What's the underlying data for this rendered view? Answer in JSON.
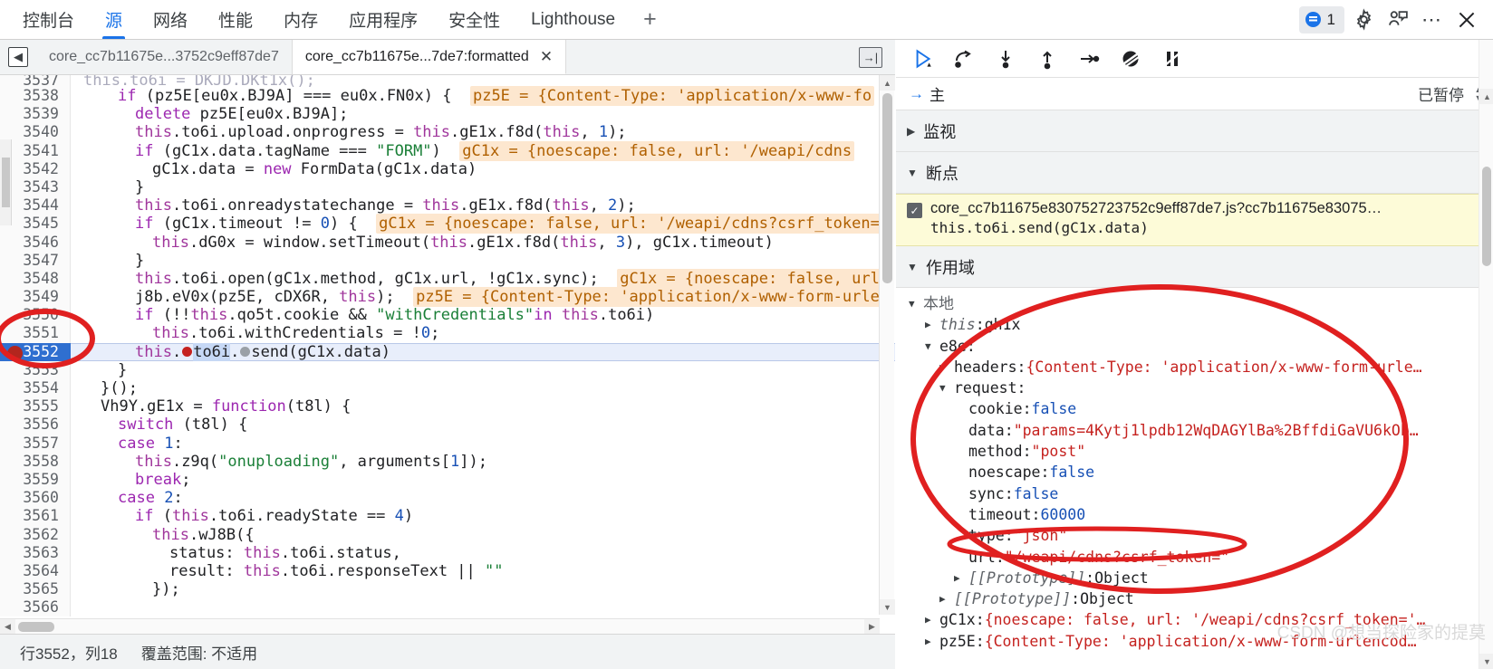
{
  "topbar": {
    "tabs": [
      {
        "label": "控制台",
        "selected": false
      },
      {
        "label": "源",
        "selected": true
      },
      {
        "label": "网络",
        "selected": false
      },
      {
        "label": "性能",
        "selected": false
      },
      {
        "label": "内存",
        "selected": false
      },
      {
        "label": "应用程序",
        "selected": false
      },
      {
        "label": "安全性",
        "selected": false
      },
      {
        "label": "Lighthouse",
        "selected": false
      }
    ],
    "add_tab_label": "+",
    "issues_count": "1",
    "icons": [
      "issues-icon",
      "gear-icon",
      "feedback-icon",
      "more-options-icon",
      "close-icon"
    ]
  },
  "filetabs": {
    "back_icon": "navigate-back-icon",
    "tabs": [
      {
        "label": "core_cc7b11675e...3752c9eff87de7",
        "active": false,
        "closable": false
      },
      {
        "label": "core_cc7b11675e...7de7:formatted",
        "active": true,
        "closable": true,
        "close_label": "✕"
      }
    ],
    "popout_icon": "open-in-new-panel-icon"
  },
  "editor": {
    "first_partial_line": "3537",
    "first_partial_text": "this.to6i = DKJD.DKt1x();",
    "lines": [
      {
        "n": "3538",
        "indent": 2,
        "segments": [
          {
            "t": "if",
            "c": "kw"
          },
          {
            "t": " (pz5E[eu0x.BJ9A] === eu0x.FN0x) {",
            "c": ""
          },
          {
            "t": "INLINE",
            "c": "",
            "v": "pz5E = {Content-Type: 'application/x-www-fo"
          }
        ]
      },
      {
        "n": "3539",
        "indent": 3,
        "segments": [
          {
            "t": "delete",
            "c": "kw"
          },
          {
            "t": " pz5E[eu0x.BJ9A];",
            "c": ""
          }
        ]
      },
      {
        "n": "3540",
        "indent": 3,
        "segments": [
          {
            "t": "this",
            "c": "this"
          },
          {
            "t": ".to6i.upload.onprogress = ",
            "c": ""
          },
          {
            "t": "this",
            "c": "this"
          },
          {
            "t": ".gE1x.f8d(",
            "c": ""
          },
          {
            "t": "this",
            "c": "this"
          },
          {
            "t": ", ",
            "c": ""
          },
          {
            "t": "1",
            "c": "num"
          },
          {
            "t": ");",
            "c": ""
          }
        ]
      },
      {
        "n": "3541",
        "indent": 3,
        "segments": [
          {
            "t": "if",
            "c": "kw"
          },
          {
            "t": " (gC1x.data.tagName === ",
            "c": ""
          },
          {
            "t": "\"FORM\"",
            "c": "str"
          },
          {
            "t": ")",
            "c": ""
          },
          {
            "t": "INLINE",
            "c": "",
            "v": "gC1x = {noescape: false, url: '/weapi/cdns"
          }
        ]
      },
      {
        "n": "3542",
        "indent": 4,
        "segments": [
          {
            "t": "gC1x.data = ",
            "c": ""
          },
          {
            "t": "new",
            "c": "kw"
          },
          {
            "t": " FormData(gC1x.data)",
            "c": ""
          }
        ]
      },
      {
        "n": "3543",
        "indent": 3,
        "segments": [
          {
            "t": "}",
            "c": ""
          }
        ]
      },
      {
        "n": "3544",
        "indent": 3,
        "segments": [
          {
            "t": "this",
            "c": "this"
          },
          {
            "t": ".to6i.onreadystatechange = ",
            "c": ""
          },
          {
            "t": "this",
            "c": "this"
          },
          {
            "t": ".gE1x.f8d(",
            "c": ""
          },
          {
            "t": "this",
            "c": "this"
          },
          {
            "t": ", ",
            "c": ""
          },
          {
            "t": "2",
            "c": "num"
          },
          {
            "t": ");",
            "c": ""
          }
        ]
      },
      {
        "n": "3545",
        "indent": 3,
        "segments": [
          {
            "t": "if",
            "c": "kw"
          },
          {
            "t": " (gC1x.timeout != ",
            "c": ""
          },
          {
            "t": "0",
            "c": "num"
          },
          {
            "t": ") {",
            "c": ""
          },
          {
            "t": "INLINE",
            "c": "",
            "v": "gC1x = {noescape: false, url: '/weapi/cdns?csrf_token="
          }
        ]
      },
      {
        "n": "3546",
        "indent": 4,
        "segments": [
          {
            "t": "this",
            "c": "this"
          },
          {
            "t": ".dG0x = window.setTimeout(",
            "c": ""
          },
          {
            "t": "this",
            "c": "this"
          },
          {
            "t": ".gE1x.f8d(",
            "c": ""
          },
          {
            "t": "this",
            "c": "this"
          },
          {
            "t": ", ",
            "c": ""
          },
          {
            "t": "3",
            "c": "num"
          },
          {
            "t": "), gC1x.timeout)",
            "c": ""
          }
        ]
      },
      {
        "n": "3547",
        "indent": 3,
        "segments": [
          {
            "t": "}",
            "c": ""
          }
        ]
      },
      {
        "n": "3548",
        "indent": 3,
        "segments": [
          {
            "t": "this",
            "c": "this"
          },
          {
            "t": ".to6i.open(gC1x.method, gC1x.url, !gC1x.sync);",
            "c": ""
          },
          {
            "t": "INLINE",
            "c": "",
            "v": "gC1x = {noescape: false, url"
          }
        ]
      },
      {
        "n": "3549",
        "indent": 3,
        "segments": [
          {
            "t": "j8b.eV0x(pz5E, cDX6R, ",
            "c": ""
          },
          {
            "t": "this",
            "c": "this"
          },
          {
            "t": ");",
            "c": ""
          },
          {
            "t": "INLINE",
            "c": "",
            "v": "pz5E = {Content-Type: 'application/x-www-form-urler"
          }
        ]
      },
      {
        "n": "3550",
        "indent": 3,
        "segments": [
          {
            "t": "if",
            "c": "kw"
          },
          {
            "t": " (!!",
            "c": ""
          },
          {
            "t": "this",
            "c": "this"
          },
          {
            "t": ".qo5t.cookie && ",
            "c": ""
          },
          {
            "t": "\"withCredentials\"",
            "c": "str"
          },
          {
            "t": "in",
            "c": "kw"
          },
          {
            "t": " ",
            "c": ""
          },
          {
            "t": "this",
            "c": "this"
          },
          {
            "t": ".to6i)",
            "c": ""
          }
        ]
      },
      {
        "n": "3551",
        "indent": 4,
        "segments": [
          {
            "t": "this",
            "c": "this"
          },
          {
            "t": ".to6i.withCredentials = !",
            "c": ""
          },
          {
            "t": "0",
            "c": "num"
          },
          {
            "t": ";",
            "c": ""
          }
        ]
      },
      {
        "n": "3552",
        "indent": 3,
        "highlight": true,
        "breakpoint": true,
        "segments": [
          {
            "t": "this",
            "c": "this"
          },
          {
            "t": ".",
            "c": ""
          },
          {
            "t": "BPDOT",
            "c": ""
          },
          {
            "t": "to6i",
            "c": "sel"
          },
          {
            "t": ".",
            "c": ""
          },
          {
            "t": "BPDOTGREY",
            "c": ""
          },
          {
            "t": "send(gC1x.data)",
            "c": ""
          }
        ]
      },
      {
        "n": "3553",
        "indent": 2,
        "segments": [
          {
            "t": "}",
            "c": ""
          }
        ]
      },
      {
        "n": "3554",
        "indent": 1,
        "segments": [
          {
            "t": "}();",
            "c": ""
          }
        ]
      },
      {
        "n": "3555",
        "indent": 1,
        "segments": [
          {
            "t": "Vh9Y.gE1x = ",
            "c": ""
          },
          {
            "t": "function",
            "c": "kw"
          },
          {
            "t": "(t8l) {",
            "c": ""
          }
        ]
      },
      {
        "n": "3556",
        "indent": 2,
        "segments": [
          {
            "t": "switch",
            "c": "kw"
          },
          {
            "t": " (t8l) {",
            "c": ""
          }
        ]
      },
      {
        "n": "3557",
        "indent": 2,
        "segments": [
          {
            "t": "case",
            "c": "kw"
          },
          {
            "t": " ",
            "c": ""
          },
          {
            "t": "1",
            "c": "num"
          },
          {
            "t": ":",
            "c": ""
          }
        ]
      },
      {
        "n": "3558",
        "indent": 3,
        "segments": [
          {
            "t": "this",
            "c": "this"
          },
          {
            "t": ".z9q(",
            "c": ""
          },
          {
            "t": "\"onuploading\"",
            "c": "str"
          },
          {
            "t": ", arguments[",
            "c": ""
          },
          {
            "t": "1",
            "c": "num"
          },
          {
            "t": "]);",
            "c": ""
          }
        ]
      },
      {
        "n": "3559",
        "indent": 3,
        "segments": [
          {
            "t": "break",
            "c": "kw"
          },
          {
            "t": ";",
            "c": ""
          }
        ]
      },
      {
        "n": "3560",
        "indent": 2,
        "segments": [
          {
            "t": "case",
            "c": "kw"
          },
          {
            "t": " ",
            "c": ""
          },
          {
            "t": "2",
            "c": "num"
          },
          {
            "t": ":",
            "c": ""
          }
        ]
      },
      {
        "n": "3561",
        "indent": 3,
        "segments": [
          {
            "t": "if",
            "c": "kw"
          },
          {
            "t": " (",
            "c": ""
          },
          {
            "t": "this",
            "c": "this"
          },
          {
            "t": ".to6i.readyState == ",
            "c": ""
          },
          {
            "t": "4",
            "c": "num"
          },
          {
            "t": ")",
            "c": ""
          }
        ]
      },
      {
        "n": "3562",
        "indent": 4,
        "segments": [
          {
            "t": "this",
            "c": "this"
          },
          {
            "t": ".wJ8B({",
            "c": ""
          }
        ]
      },
      {
        "n": "3563",
        "indent": 5,
        "segments": [
          {
            "t": "status: ",
            "c": ""
          },
          {
            "t": "this",
            "c": "this"
          },
          {
            "t": ".to6i.status,",
            "c": ""
          }
        ]
      },
      {
        "n": "3564",
        "indent": 5,
        "segments": [
          {
            "t": "result: ",
            "c": ""
          },
          {
            "t": "this",
            "c": "this"
          },
          {
            "t": ".to6i.responseText || ",
            "c": ""
          },
          {
            "t": "\"\"",
            "c": "str"
          }
        ]
      },
      {
        "n": "3565",
        "indent": 4,
        "segments": [
          {
            "t": "});",
            "c": ""
          }
        ]
      },
      {
        "n": "3566",
        "indent": 0,
        "segments": []
      }
    ]
  },
  "statusbar": {
    "position": "行3552，列18",
    "coverage": "覆盖范围: 不适用"
  },
  "debugger": {
    "toolbar_icons": [
      "resume-script-execution-icon",
      "step-over-next-function-call-icon",
      "step-into-next-function-call-icon",
      "step-out-of-current-function-icon",
      "step-icon",
      "deactivate-breakpoints-icon",
      "pause-on-exceptions-icon"
    ],
    "thread": {
      "name": "主",
      "status": "已暂停",
      "arrow": "→"
    },
    "sections": {
      "watch": {
        "label": "监视",
        "expanded": false
      },
      "breakpoints": {
        "label": "断点",
        "expanded": true
      },
      "scope": {
        "label": "作用域",
        "expanded": true
      }
    },
    "breakpoint": {
      "checked": true,
      "check_glyph": "✓",
      "file": "core_cc7b11675e830752723752c9eff87de7.js?cc7b11675e83075…",
      "snippet": "this.to6i.send(gC1x.data)"
    },
    "scope": {
      "group": "本地",
      "rows": [
        {
          "depth": 1,
          "arrow": "▶",
          "name": "this",
          "italic": true,
          "sep": ": ",
          "value": "gh1x",
          "vclass": "sval-obj"
        },
        {
          "depth": 1,
          "arrow": "▼",
          "name": "e8e",
          "italic": false,
          "sep": ":",
          "value": "",
          "vclass": "sval-obj"
        },
        {
          "depth": 2,
          "arrow": "▶",
          "name": "headers",
          "italic": false,
          "sep": ": ",
          "value": "{Content-Type: 'application/x-www-form-urle…",
          "vclass": "sval-prev"
        },
        {
          "depth": 2,
          "arrow": "▼",
          "name": "request",
          "italic": false,
          "sep": ":",
          "value": "",
          "vclass": "sval-obj"
        },
        {
          "depth": 3,
          "arrow": "",
          "name": "cookie",
          "italic": false,
          "sep": ": ",
          "value": "false",
          "vclass": "sval-bool"
        },
        {
          "depth": 3,
          "arrow": "",
          "name": "data",
          "italic": false,
          "sep": ": ",
          "value": "\"params=4Kytj1lpdb12WqDAGYlBa%2BffdiGaVU6kOb…",
          "vclass": "sval-str"
        },
        {
          "depth": 3,
          "arrow": "",
          "name": "method",
          "italic": false,
          "sep": ": ",
          "value": "\"post\"",
          "vclass": "sval-str"
        },
        {
          "depth": 3,
          "arrow": "",
          "name": "noescape",
          "italic": false,
          "sep": ": ",
          "value": "false",
          "vclass": "sval-bool"
        },
        {
          "depth": 3,
          "arrow": "",
          "name": "sync",
          "italic": false,
          "sep": ": ",
          "value": "false",
          "vclass": "sval-bool"
        },
        {
          "depth": 3,
          "arrow": "",
          "name": "timeout",
          "italic": false,
          "sep": ": ",
          "value": "60000",
          "vclass": "sval-num"
        },
        {
          "depth": 3,
          "arrow": "",
          "name": "type",
          "italic": false,
          "sep": ": ",
          "value": "\"json\"",
          "vclass": "sval-str"
        },
        {
          "depth": 3,
          "arrow": "",
          "name": "url",
          "italic": false,
          "sep": ": ",
          "value": "\"/weapi/cdns?csrf_token=\"",
          "vclass": "sval-str"
        },
        {
          "depth": 3,
          "arrow": "▶",
          "name": "[[Prototype]]",
          "italic": true,
          "sep": ": ",
          "value": "Object",
          "vclass": "sval-obj"
        },
        {
          "depth": 2,
          "arrow": "▶",
          "name": "[[Prototype]]",
          "italic": true,
          "sep": ": ",
          "value": "Object",
          "vclass": "sval-obj"
        },
        {
          "depth": 1,
          "arrow": "▶",
          "name": "gC1x",
          "italic": false,
          "sep": ": ",
          "value": "{noescape: false, url: '/weapi/cdns?csrf_token='…",
          "vclass": "sval-prev"
        },
        {
          "depth": 1,
          "arrow": "▶",
          "name": "pz5E",
          "italic": false,
          "sep": ": ",
          "value": "{Content-Type: 'application/x-www-form-urlencod…",
          "vclass": "sval-prev"
        }
      ]
    }
  },
  "annotations": {
    "ellipse_line_marker": "red-ellipse-around-line-3552",
    "ellipse_scope_marker": "red-ellipse-around-scope-values",
    "ellipse_url_marker": "red-ellipse-around-url-value",
    "accent_red": "#e02020",
    "accent_blue": "#1a73e8",
    "highlight_row": "#e8eefb"
  },
  "watermark": {
    "text": "CSDN @想当探险家的提莫"
  }
}
